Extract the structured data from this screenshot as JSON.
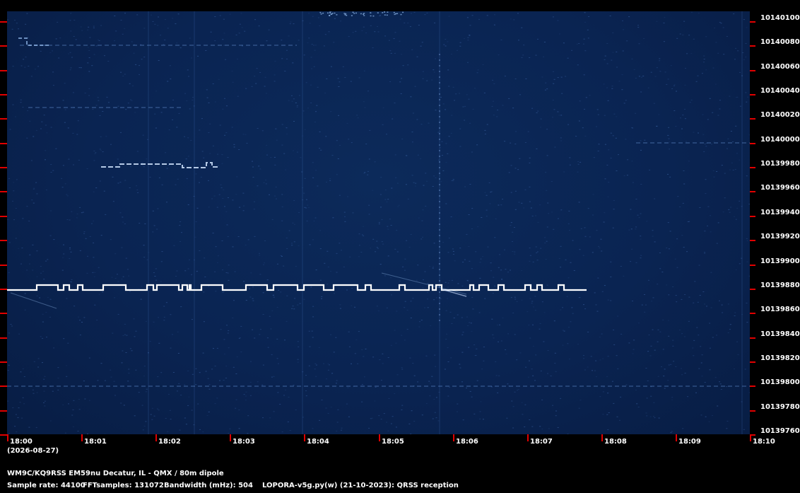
{
  "spectrogram": {
    "date": "(2026-08-27)",
    "time_labels": [
      "18:00",
      "18:01",
      "18:02",
      "18:03",
      "18:04",
      "18:05",
      "18:06",
      "18:07",
      "18:08",
      "18:09",
      "18:10"
    ],
    "freq_labels": [
      "10140100",
      "10140080",
      "10140060",
      "10140040",
      "10140020",
      "10140000",
      "10139980",
      "10139960",
      "10139940",
      "10139920",
      "10139900",
      "10139880",
      "10139860",
      "10139840",
      "10139820",
      "10139800",
      "10139780",
      "10139760"
    ],
    "background_color": "#0a2452",
    "tick_color": "#e00000",
    "trace_color": "#ffffff"
  },
  "footer": {
    "line1": "WM9C/KQ9RSS EM59nu Decatur, IL - QMX / 80m dipole",
    "sample_rate": "Sample rate: 44100",
    "fft_samples": "FFTsamples: 131072",
    "bandwidth": "Bandwidth (mHz): 504",
    "software": "LOPORA-v5g.py(w) (21-10-2023): QRSS reception"
  }
}
